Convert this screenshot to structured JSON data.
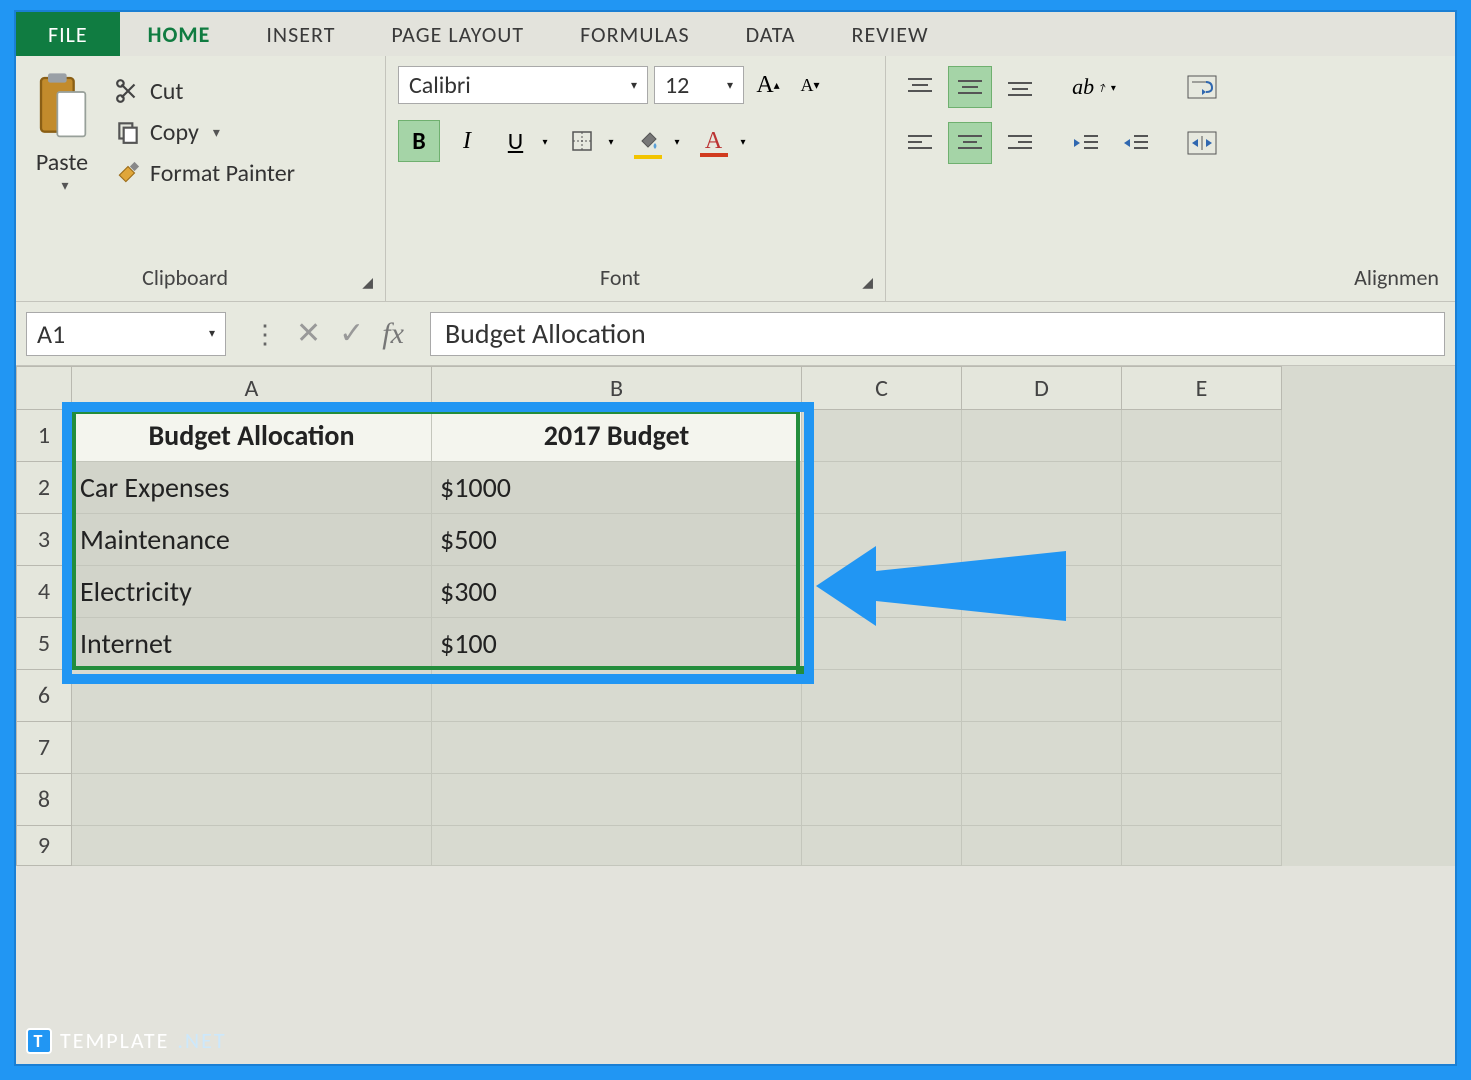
{
  "tabs": {
    "file": "FILE",
    "home": "HOME",
    "insert": "INSERT",
    "page_layout": "PAGE LAYOUT",
    "formulas": "FORMULAS",
    "data": "DATA",
    "review": "REVIEW"
  },
  "ribbon": {
    "clipboard": {
      "paste": "Paste",
      "cut": "Cut",
      "copy": "Copy",
      "format_painter": "Format Painter",
      "group_label": "Clipboard"
    },
    "font": {
      "font_name": "Calibri",
      "font_size": "12",
      "bold": "B",
      "italic": "I",
      "underline": "U",
      "group_label": "Font"
    },
    "alignment": {
      "group_label": "Alignmen"
    }
  },
  "formula_bar": {
    "name_box": "A1",
    "fx": "fx",
    "value": "Budget Allocation"
  },
  "grid": {
    "columns": [
      "A",
      "B",
      "C",
      "D",
      "E"
    ],
    "rows": [
      "1",
      "2",
      "3",
      "4",
      "5",
      "6",
      "7",
      "8",
      "9"
    ],
    "data": {
      "A1": "Budget Allocation",
      "B1": "2017 Budget",
      "A2": "Car Expenses",
      "B2": "$1000",
      "A3": "Maintenance",
      "B3": "$500",
      "A4": "Electricity",
      "B4": "$300",
      "A5": "Internet",
      "B5": "$100"
    }
  },
  "watermark": {
    "brand": "TEMPLATE",
    "suffix": ".NET"
  },
  "colors": {
    "excel_green": "#107c41",
    "accent_blue": "#2196f3",
    "selection_green": "#238d3c",
    "fill_yellow": "#f2c400",
    "font_red": "#d13b1f"
  }
}
